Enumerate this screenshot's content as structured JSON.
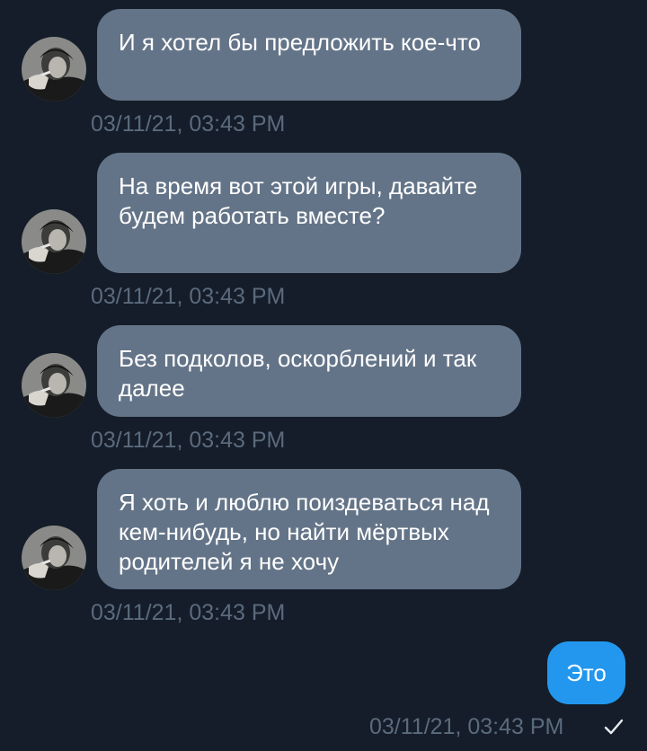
{
  "messages_in": [
    {
      "text": "И я хотел бы предложить кое-что",
      "time": "03/11/21, 03:43 PM"
    },
    {
      "text": "На время вот этой игры, давайте будем работать вместе?",
      "time": "03/11/21, 03:43 PM"
    },
    {
      "text": "Без подколов, оскорблений и так далее",
      "time": "03/11/21, 03:43 PM"
    },
    {
      "text": "Я хоть и люблю поиздеваться над кем-нибудь, но найти мёртвых родителей я не хочу",
      "time": "03/11/21, 03:43 PM"
    }
  ],
  "message_out": {
    "text": "Это",
    "time": "03/11/21, 03:43 PM",
    "status_icon": "check-icon"
  },
  "colors": {
    "background": "#141d29",
    "incoming_bubble": "#647488",
    "outgoing_bubble": "#2397ee",
    "timestamp": "#5b6a7d"
  }
}
